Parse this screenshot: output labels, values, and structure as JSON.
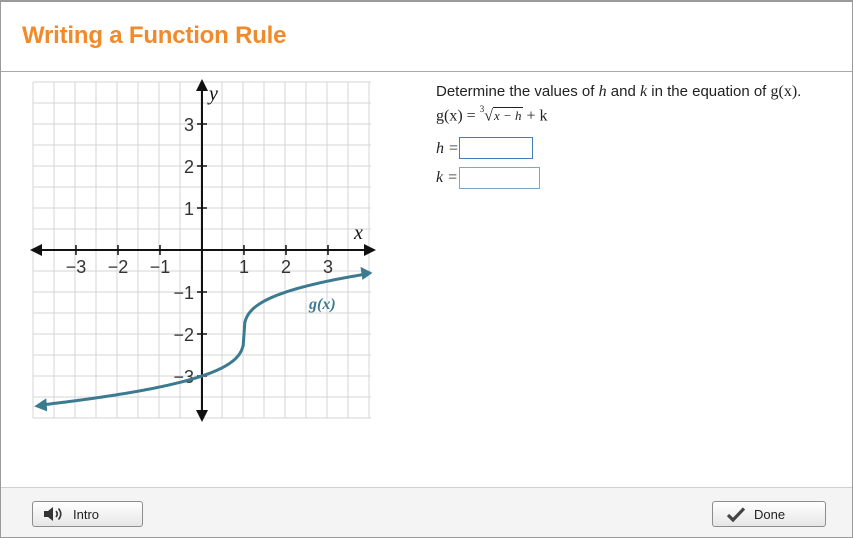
{
  "header": {
    "title": "Writing a Function Rule"
  },
  "question": {
    "prompt_prefix": "Determine the values of ",
    "var_h": "h",
    "prompt_mid": " and ",
    "var_k": "k",
    "prompt_mid2": " in the equation of ",
    "func": "g(x)",
    "prompt_end": ".",
    "equation_lhs": "g(x) = ",
    "equation_index": "3",
    "equation_radicand": "x − h",
    "equation_tail": " + k"
  },
  "answers": {
    "h_label": "h =",
    "h_value": "",
    "k_label": "k =",
    "k_value": ""
  },
  "graph": {
    "x_axis_label": "x",
    "y_axis_label": "y",
    "curve_label": "g(x)",
    "x_ticks": [
      "−3",
      "−2",
      "−1",
      "1",
      "2",
      "3"
    ],
    "y_ticks": [
      "3",
      "2",
      "1",
      "−1",
      "−2",
      "−3"
    ],
    "curve_color": "#3b7a8f"
  },
  "footer": {
    "intro_label": "Intro",
    "done_label": "Done"
  },
  "icons": {
    "intro": "speaker-icon",
    "done": "checkmark-icon"
  }
}
